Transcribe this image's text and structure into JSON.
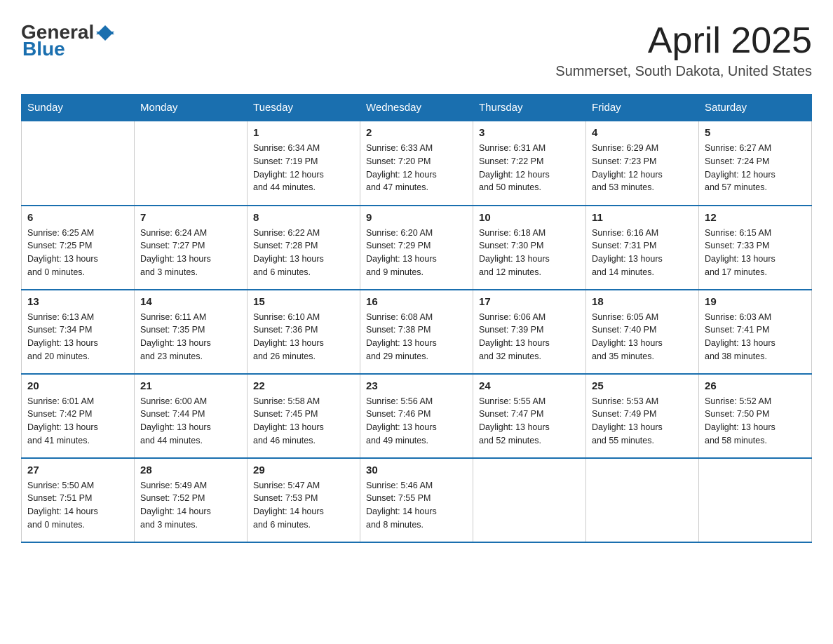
{
  "logo": {
    "general": "General",
    "blue": "Blue"
  },
  "title": "April 2025",
  "location": "Summerset, South Dakota, United States",
  "weekdays": [
    "Sunday",
    "Monday",
    "Tuesday",
    "Wednesday",
    "Thursday",
    "Friday",
    "Saturday"
  ],
  "weeks": [
    [
      {
        "day": "",
        "detail": ""
      },
      {
        "day": "",
        "detail": ""
      },
      {
        "day": "1",
        "detail": "Sunrise: 6:34 AM\nSunset: 7:19 PM\nDaylight: 12 hours\nand 44 minutes."
      },
      {
        "day": "2",
        "detail": "Sunrise: 6:33 AM\nSunset: 7:20 PM\nDaylight: 12 hours\nand 47 minutes."
      },
      {
        "day": "3",
        "detail": "Sunrise: 6:31 AM\nSunset: 7:22 PM\nDaylight: 12 hours\nand 50 minutes."
      },
      {
        "day": "4",
        "detail": "Sunrise: 6:29 AM\nSunset: 7:23 PM\nDaylight: 12 hours\nand 53 minutes."
      },
      {
        "day": "5",
        "detail": "Sunrise: 6:27 AM\nSunset: 7:24 PM\nDaylight: 12 hours\nand 57 minutes."
      }
    ],
    [
      {
        "day": "6",
        "detail": "Sunrise: 6:25 AM\nSunset: 7:25 PM\nDaylight: 13 hours\nand 0 minutes."
      },
      {
        "day": "7",
        "detail": "Sunrise: 6:24 AM\nSunset: 7:27 PM\nDaylight: 13 hours\nand 3 minutes."
      },
      {
        "day": "8",
        "detail": "Sunrise: 6:22 AM\nSunset: 7:28 PM\nDaylight: 13 hours\nand 6 minutes."
      },
      {
        "day": "9",
        "detail": "Sunrise: 6:20 AM\nSunset: 7:29 PM\nDaylight: 13 hours\nand 9 minutes."
      },
      {
        "day": "10",
        "detail": "Sunrise: 6:18 AM\nSunset: 7:30 PM\nDaylight: 13 hours\nand 12 minutes."
      },
      {
        "day": "11",
        "detail": "Sunrise: 6:16 AM\nSunset: 7:31 PM\nDaylight: 13 hours\nand 14 minutes."
      },
      {
        "day": "12",
        "detail": "Sunrise: 6:15 AM\nSunset: 7:33 PM\nDaylight: 13 hours\nand 17 minutes."
      }
    ],
    [
      {
        "day": "13",
        "detail": "Sunrise: 6:13 AM\nSunset: 7:34 PM\nDaylight: 13 hours\nand 20 minutes."
      },
      {
        "day": "14",
        "detail": "Sunrise: 6:11 AM\nSunset: 7:35 PM\nDaylight: 13 hours\nand 23 minutes."
      },
      {
        "day": "15",
        "detail": "Sunrise: 6:10 AM\nSunset: 7:36 PM\nDaylight: 13 hours\nand 26 minutes."
      },
      {
        "day": "16",
        "detail": "Sunrise: 6:08 AM\nSunset: 7:38 PM\nDaylight: 13 hours\nand 29 minutes."
      },
      {
        "day": "17",
        "detail": "Sunrise: 6:06 AM\nSunset: 7:39 PM\nDaylight: 13 hours\nand 32 minutes."
      },
      {
        "day": "18",
        "detail": "Sunrise: 6:05 AM\nSunset: 7:40 PM\nDaylight: 13 hours\nand 35 minutes."
      },
      {
        "day": "19",
        "detail": "Sunrise: 6:03 AM\nSunset: 7:41 PM\nDaylight: 13 hours\nand 38 minutes."
      }
    ],
    [
      {
        "day": "20",
        "detail": "Sunrise: 6:01 AM\nSunset: 7:42 PM\nDaylight: 13 hours\nand 41 minutes."
      },
      {
        "day": "21",
        "detail": "Sunrise: 6:00 AM\nSunset: 7:44 PM\nDaylight: 13 hours\nand 44 minutes."
      },
      {
        "day": "22",
        "detail": "Sunrise: 5:58 AM\nSunset: 7:45 PM\nDaylight: 13 hours\nand 46 minutes."
      },
      {
        "day": "23",
        "detail": "Sunrise: 5:56 AM\nSunset: 7:46 PM\nDaylight: 13 hours\nand 49 minutes."
      },
      {
        "day": "24",
        "detail": "Sunrise: 5:55 AM\nSunset: 7:47 PM\nDaylight: 13 hours\nand 52 minutes."
      },
      {
        "day": "25",
        "detail": "Sunrise: 5:53 AM\nSunset: 7:49 PM\nDaylight: 13 hours\nand 55 minutes."
      },
      {
        "day": "26",
        "detail": "Sunrise: 5:52 AM\nSunset: 7:50 PM\nDaylight: 13 hours\nand 58 minutes."
      }
    ],
    [
      {
        "day": "27",
        "detail": "Sunrise: 5:50 AM\nSunset: 7:51 PM\nDaylight: 14 hours\nand 0 minutes."
      },
      {
        "day": "28",
        "detail": "Sunrise: 5:49 AM\nSunset: 7:52 PM\nDaylight: 14 hours\nand 3 minutes."
      },
      {
        "day": "29",
        "detail": "Sunrise: 5:47 AM\nSunset: 7:53 PM\nDaylight: 14 hours\nand 6 minutes."
      },
      {
        "day": "30",
        "detail": "Sunrise: 5:46 AM\nSunset: 7:55 PM\nDaylight: 14 hours\nand 8 minutes."
      },
      {
        "day": "",
        "detail": ""
      },
      {
        "day": "",
        "detail": ""
      },
      {
        "day": "",
        "detail": ""
      }
    ]
  ]
}
